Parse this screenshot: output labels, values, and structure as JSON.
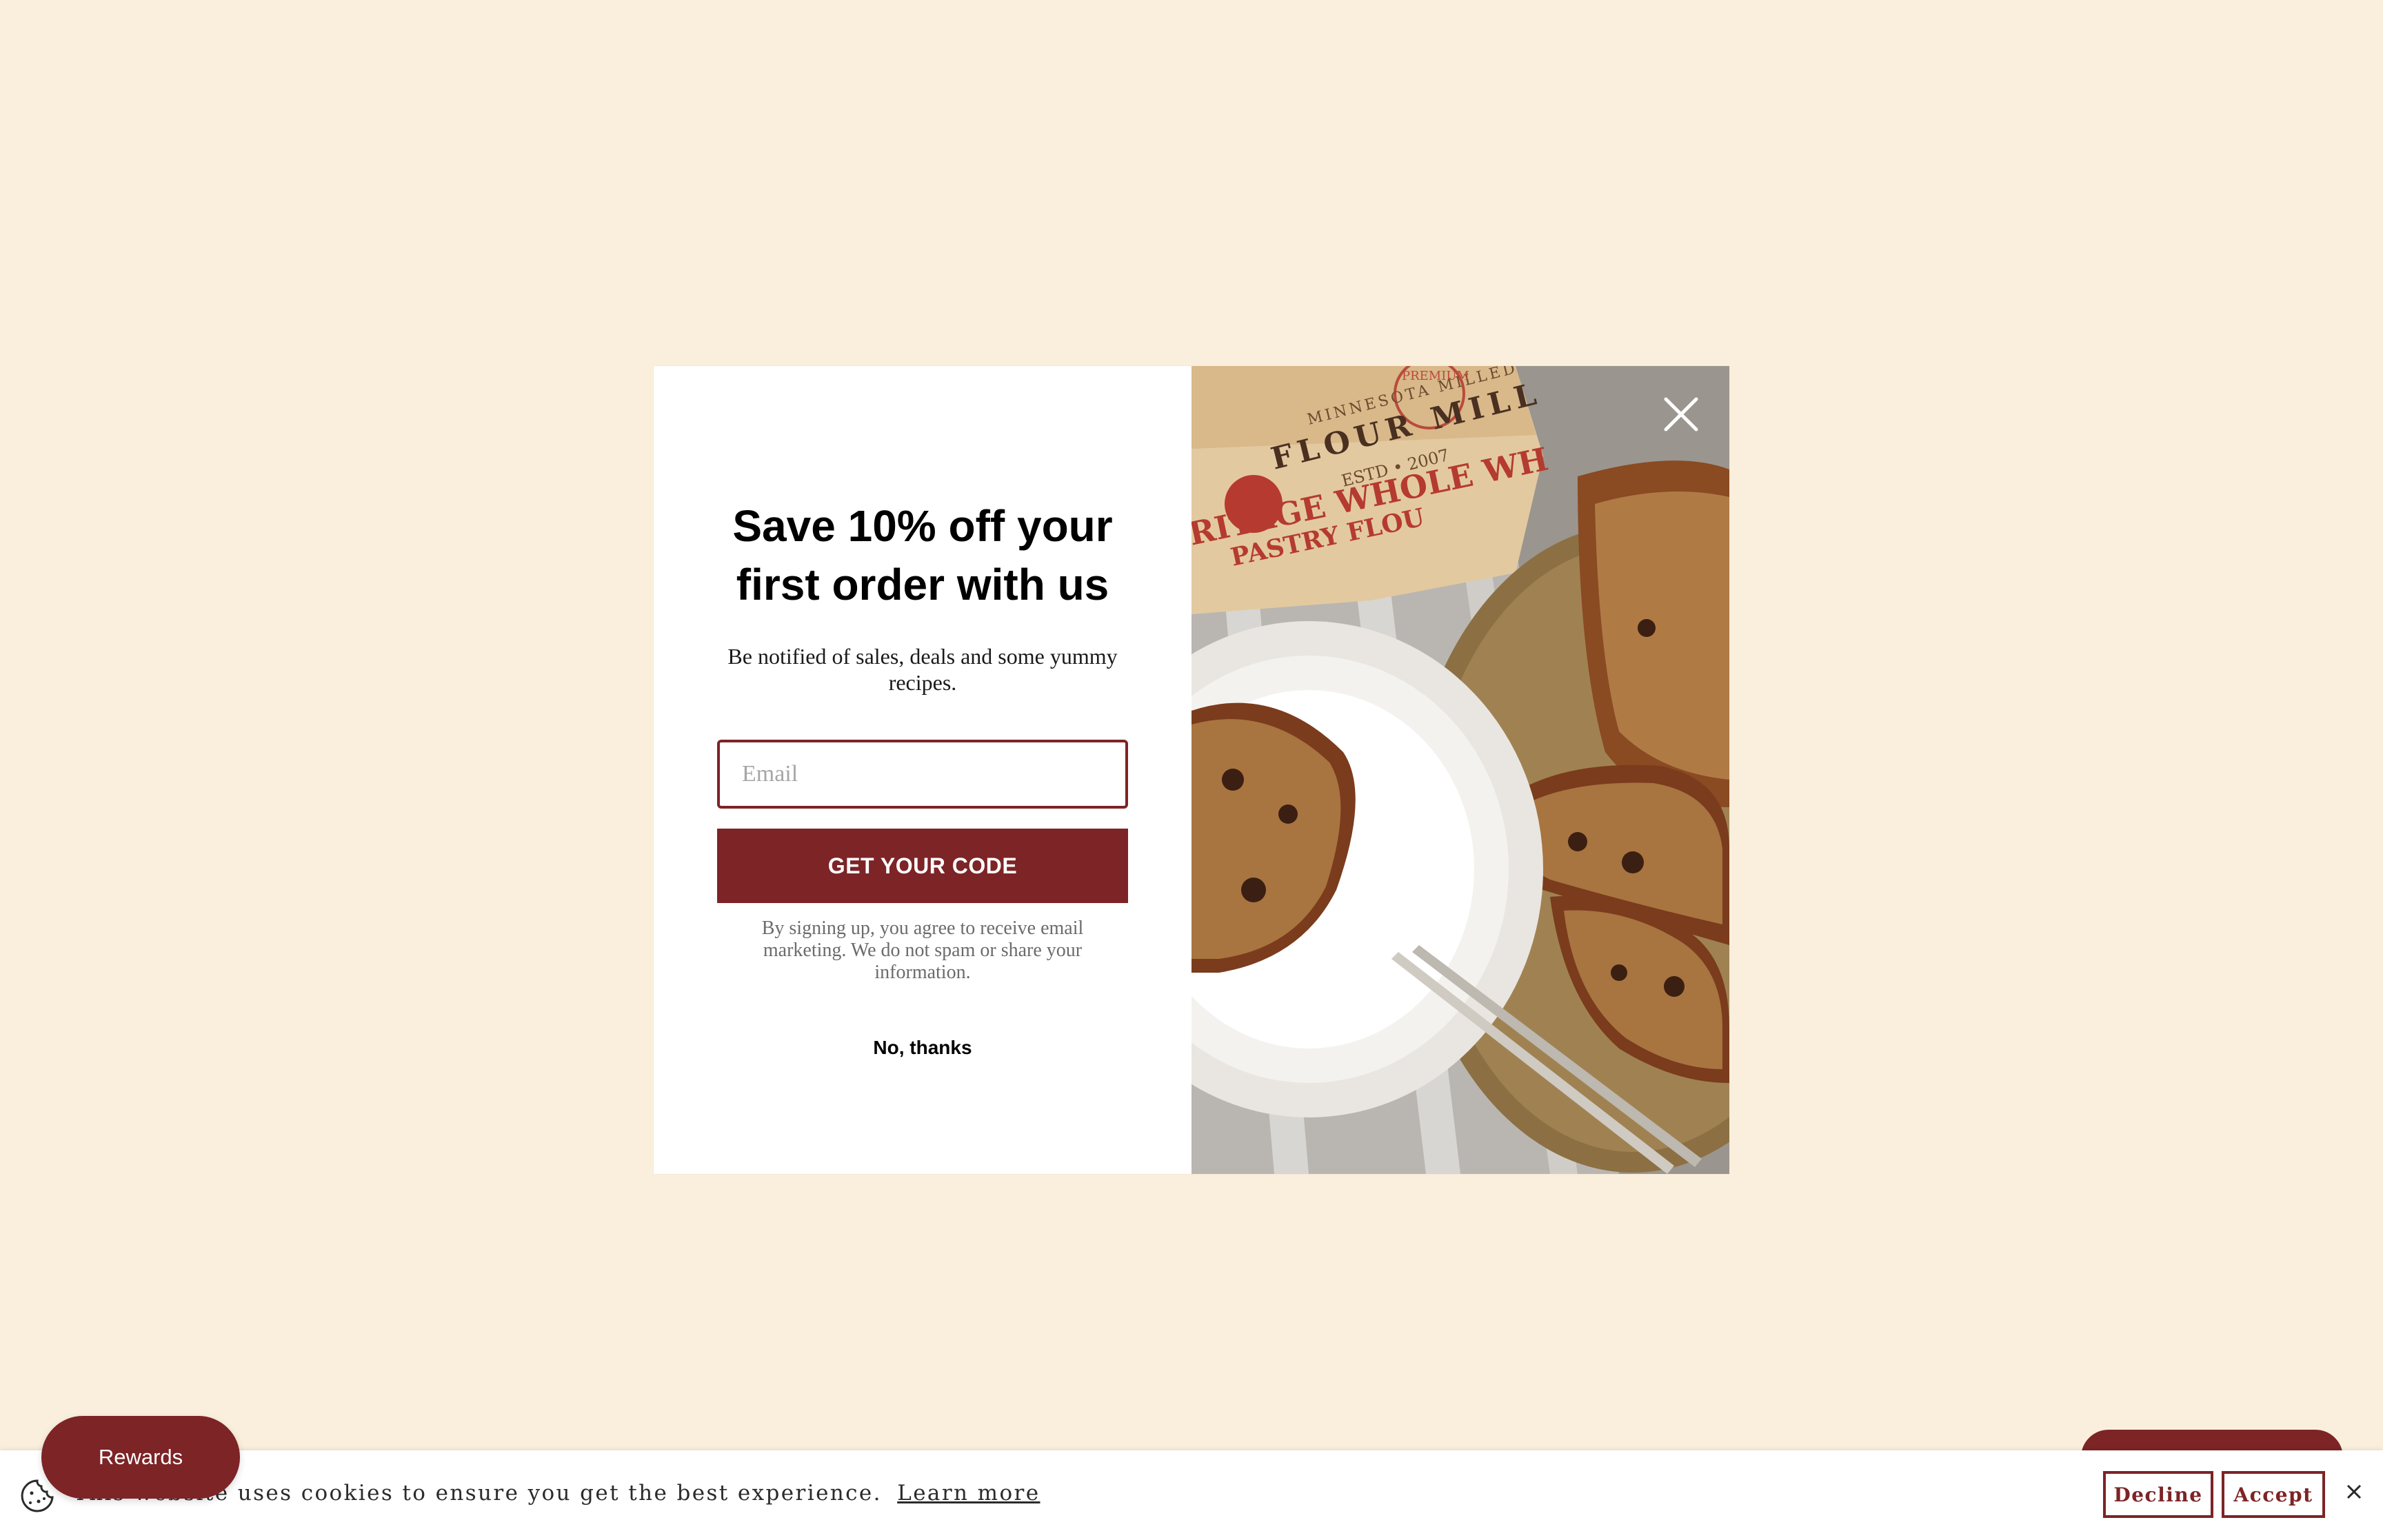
{
  "popup": {
    "title": "Save 10% off your first order with us",
    "subtitle": "Be notified of sales, deals and some yummy recipes.",
    "email_placeholder": "Email",
    "email_value": "",
    "cta_label": "GET YOUR CODE",
    "disclaimer": "By signing up, you agree to receive email marketing. We do not spam or share your information.",
    "dismiss_label": "No, thanks",
    "close_icon": "close-icon",
    "image": {
      "bag_brand_line1": "MINNESOTA MILLED",
      "bag_brand_line2": "FLOUR MILL",
      "bag_established": "ESTD • 2007",
      "bag_badge": "PREMIUM",
      "bag_product": "RITAGE WHOLE WH",
      "bag_product_line2": "PASTRY FLOU"
    }
  },
  "cookie_bar": {
    "message": "This website uses cookies to ensure you get the best experience.",
    "learn_more": "Learn more",
    "decline": "Decline",
    "accept": "Accept",
    "close_icon": "close-icon"
  },
  "rewards": {
    "label": "Rewards"
  },
  "colors": {
    "page_background": "#faefdc",
    "brand": "#7d2426",
    "text": "#000000"
  }
}
